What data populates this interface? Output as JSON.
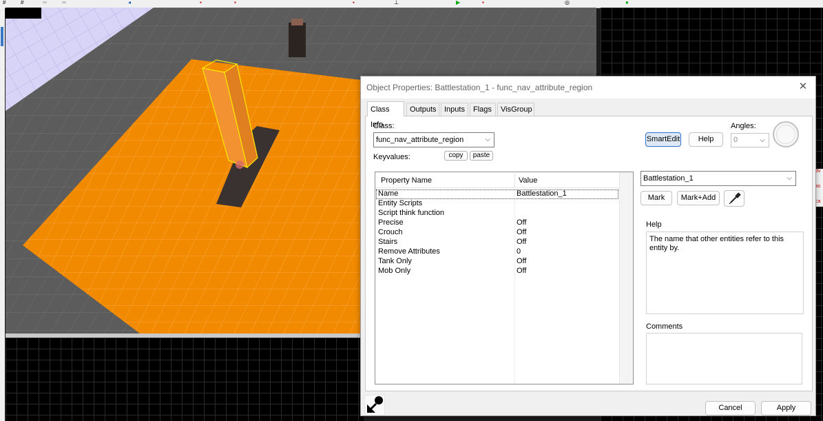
{
  "dialog": {
    "title": "Object Properties: Battlestation_1 - func_nav_attribute_region",
    "close_glyph": "✕",
    "tabs": [
      {
        "label": "Class Info",
        "active": true
      },
      {
        "label": "Outputs",
        "active": false
      },
      {
        "label": "Inputs",
        "active": false
      },
      {
        "label": "Flags",
        "active": false
      },
      {
        "label": "VisGroup",
        "active": false
      }
    ],
    "class_label": "Class:",
    "class_value": "func_nav_attribute_region",
    "keyvalues_label": "Keyvalues:",
    "copy_label": "copy",
    "paste_label": "paste",
    "smartedit_label": "SmartEdit",
    "help_button_label": "Help",
    "angles_label": "Angles:",
    "angles_value": "0",
    "table": {
      "columns": [
        "Property Name",
        "Value"
      ],
      "rows": [
        {
          "key": "Name",
          "value": "Battlestation_1",
          "selected": true
        },
        {
          "key": "Entity Scripts",
          "value": ""
        },
        {
          "key": "Script think function",
          "value": ""
        },
        {
          "key": "Precise",
          "value": "Off"
        },
        {
          "key": "Crouch",
          "value": "Off"
        },
        {
          "key": "Stairs",
          "value": "Off"
        },
        {
          "key": "Remove Attributes",
          "value": "0"
        },
        {
          "key": "Tank Only",
          "value": "Off"
        },
        {
          "key": "Mob Only",
          "value": "Off"
        }
      ]
    },
    "value_field": "Battlestation_1",
    "mark_label": "Mark",
    "mark_add_label": "Mark+Add",
    "help_section_label": "Help",
    "help_text": "The name that other entities refer to this entity by.",
    "comments_label": "Comments",
    "comments_text": "",
    "cancel_label": "Cancel",
    "apply_label": "Apply"
  },
  "colors": {
    "floor_orange": "#f28a00",
    "selection_yellow": "#ffe800",
    "primary_button_border": "#2f6fd0"
  },
  "icons": {
    "close": "close-icon",
    "eyedropper": "eyedropper-icon",
    "pick_entity": "pick-entity-icon",
    "chevron": "chevron-down-icon"
  },
  "background": {
    "right_widget_glyph_top": "3v",
    "right_widget_glyph_mid": "as",
    "right_widget_glyph_bottom": "ca"
  }
}
